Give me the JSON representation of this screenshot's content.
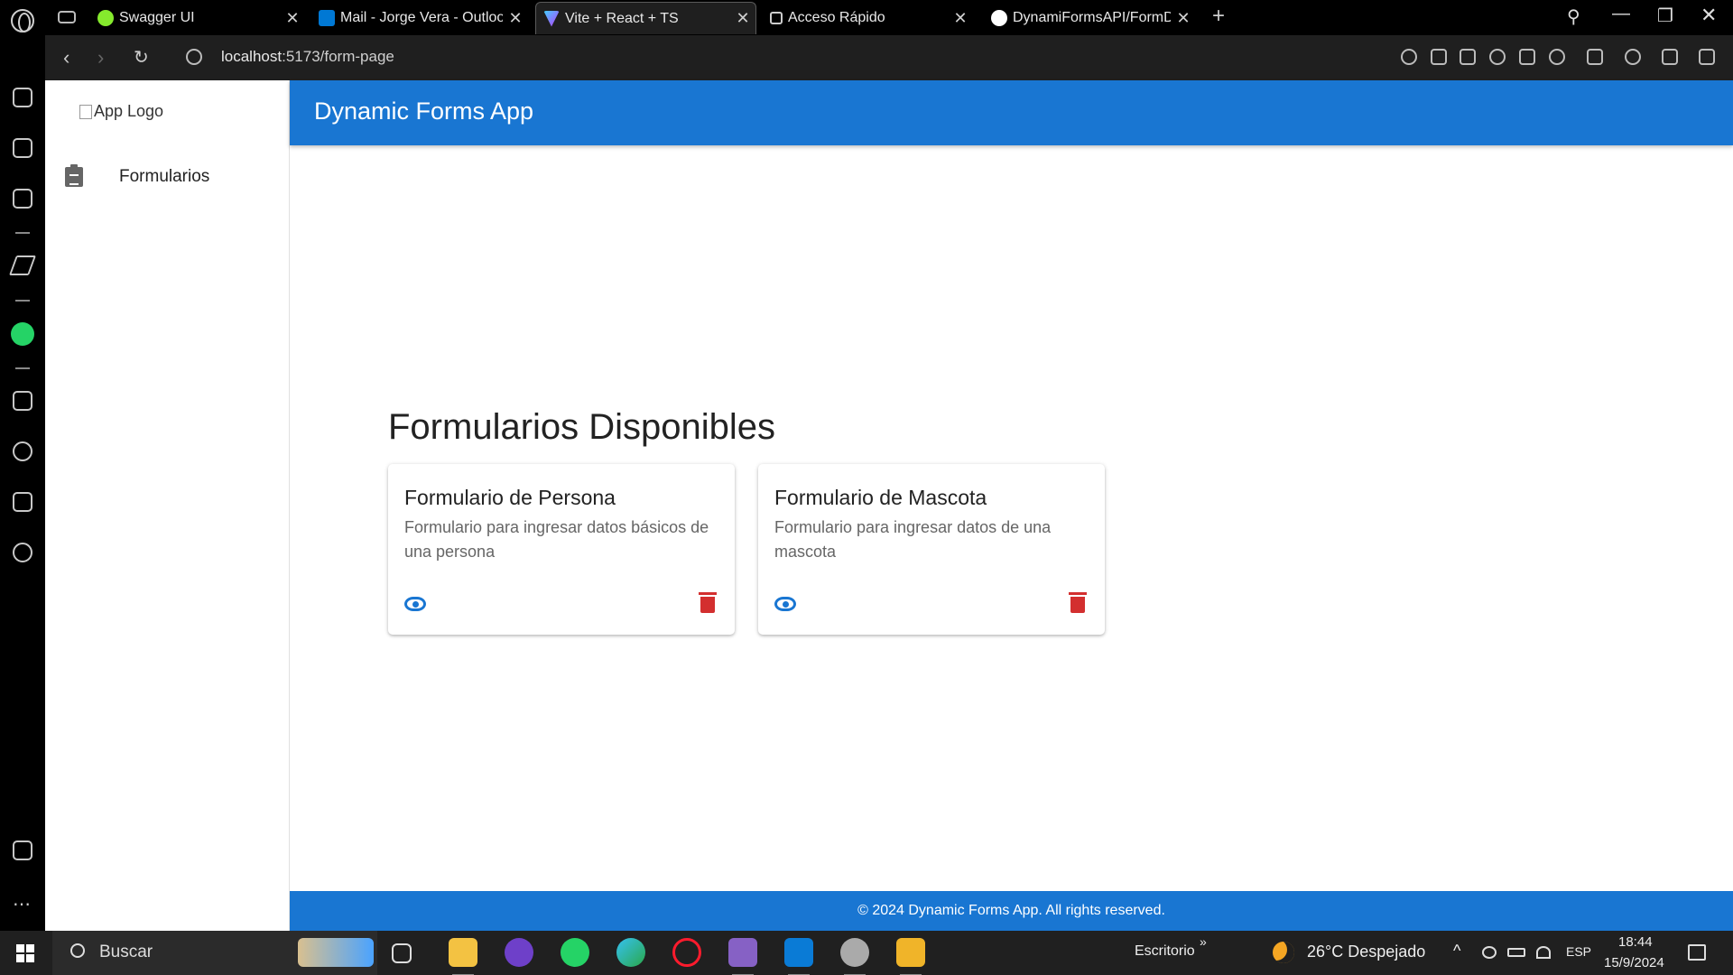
{
  "browser": {
    "tabs": [
      {
        "title": "Swagger UI",
        "favicon_color": "#85ea2d"
      },
      {
        "title": "Mail - Jorge Vera - Outlook",
        "favicon_color": "#0078d4"
      },
      {
        "title": "Vite + React + TS",
        "favicon_color": "#bd34fe",
        "active": true
      },
      {
        "title": "Acceso Rápido",
        "favicon_color": "#cccccc"
      },
      {
        "title": "DynamiFormsAPI/FormDyn",
        "favicon_color": "#ffffff"
      }
    ],
    "url_host": "localhost",
    "url_path": ":5173/form-page"
  },
  "app": {
    "logo_alt": "App Logo",
    "nav_items": [
      {
        "label": "Formularios",
        "icon": "clipboard-icon"
      }
    ],
    "title": "Dynamic Forms App",
    "section_title": "Formularios Disponibles",
    "cards": [
      {
        "title": "Formulario de Persona",
        "description": "Formulario para ingresar datos básicos de una persona"
      },
      {
        "title": "Formulario de Mascota",
        "description": "Formulario para ingresar datos de una mascota"
      }
    ],
    "footer": "© 2024 Dynamic Forms App. All rights reserved.",
    "colors": {
      "primary": "#1976d2",
      "danger": "#d32f2f"
    }
  },
  "taskbar": {
    "search_placeholder": "Buscar",
    "desktop_label": "Escritorio",
    "weather": "26°C  Despejado",
    "language": "ESP",
    "time": "18:44",
    "date": "15/9/2024"
  }
}
